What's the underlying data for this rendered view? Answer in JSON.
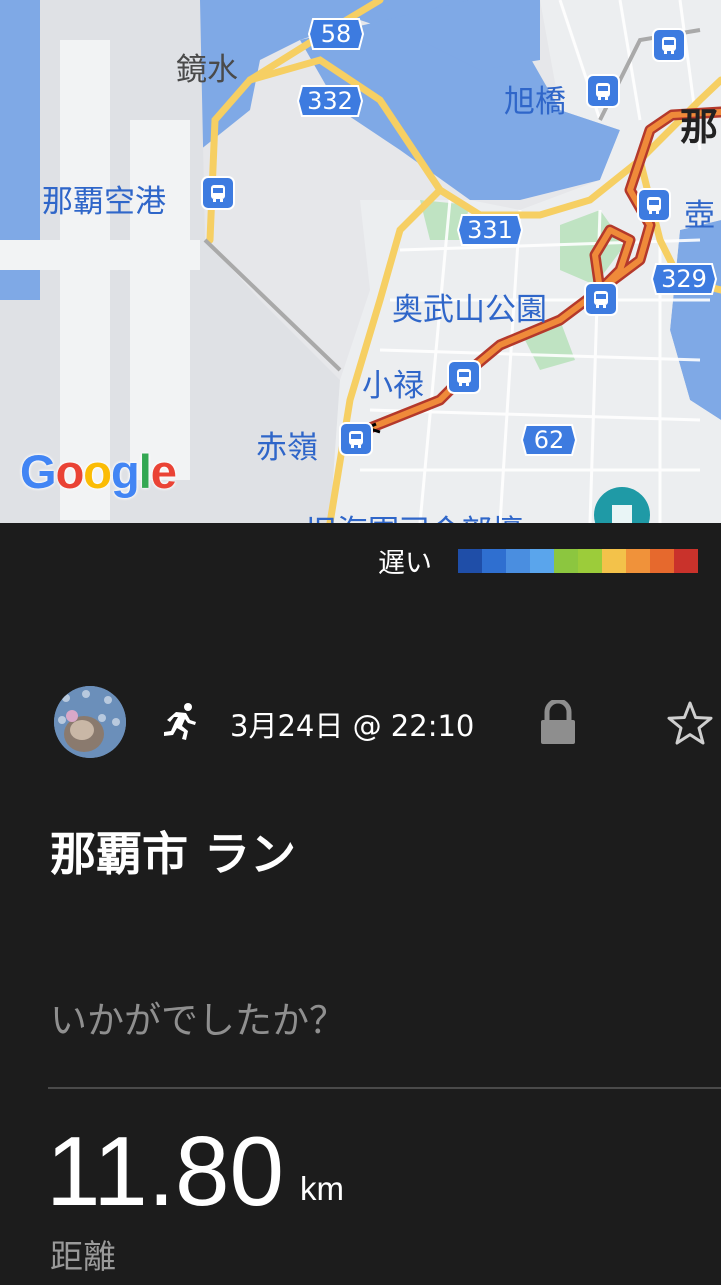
{
  "map": {
    "places": {
      "kyomizu": "鏡水",
      "naha_airport": "那覇空港",
      "asahibashi": "旭橋",
      "naha_city": "那",
      "tsubo": "壺",
      "onoyama_koen": "奥武山公園",
      "oroku": "小禄",
      "akamine": "赤嶺",
      "kyukaigun": "旧海軍司令部壕"
    },
    "routes": [
      "58",
      "332",
      "331",
      "329",
      "62"
    ],
    "attribution": "Google",
    "route_color": "#e8772e"
  },
  "legend": {
    "label": "遅い",
    "colors": [
      "#1f4ea8",
      "#2f6fd0",
      "#4a8ee0",
      "#5aa5ec",
      "#8cc63f",
      "#9ccc3a",
      "#f3c24a",
      "#f0923a",
      "#e6692d",
      "#c9322b"
    ]
  },
  "activity": {
    "type_icon": "running-icon",
    "datetime": "3月24日 @ 22:10",
    "privacy_icon": "lock-icon",
    "favorite_icon": "star-icon",
    "title": "那覇市 ラン",
    "feedback_prompt": "いかがでしたか？",
    "distance_value": "11.80",
    "distance_unit": "km",
    "distance_label": "距離"
  }
}
